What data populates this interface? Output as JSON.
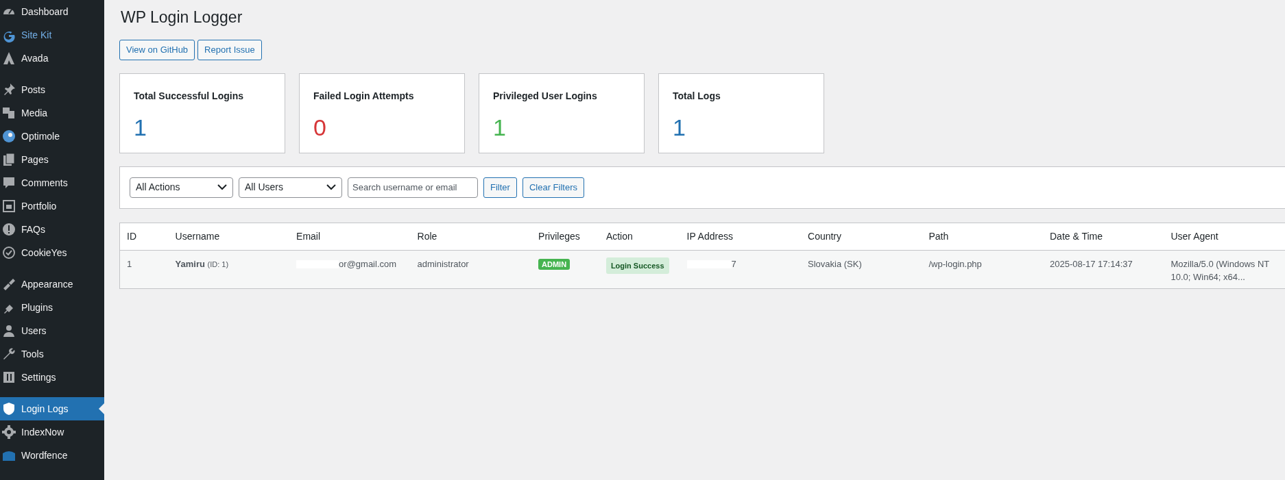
{
  "sidebar": {
    "groups": [
      {
        "items": [
          {
            "label": "Dashboard",
            "selected": false,
            "color": "#f0f0f1"
          },
          {
            "label": "Site Kit",
            "selected": false,
            "color": "#72aee6"
          },
          {
            "label": "Avada",
            "selected": false,
            "color": "#f0f0f1"
          }
        ]
      },
      {
        "items": [
          {
            "label": "Posts",
            "selected": false,
            "color": "#f0f0f1"
          },
          {
            "label": "Media",
            "selected": false,
            "color": "#f0f0f1"
          },
          {
            "label": "Optimole",
            "selected": false,
            "color": "#f0f0f1"
          },
          {
            "label": "Pages",
            "selected": false,
            "color": "#f0f0f1"
          },
          {
            "label": "Comments",
            "selected": false,
            "color": "#f0f0f1"
          },
          {
            "label": "Portfolio",
            "selected": false,
            "color": "#f0f0f1"
          },
          {
            "label": "FAQs",
            "selected": false,
            "color": "#f0f0f1"
          },
          {
            "label": "CookieYes",
            "selected": false,
            "color": "#f0f0f1"
          }
        ]
      },
      {
        "items": [
          {
            "label": "Appearance",
            "selected": false,
            "color": "#f0f0f1"
          },
          {
            "label": "Plugins",
            "selected": false,
            "color": "#f0f0f1"
          },
          {
            "label": "Users",
            "selected": false,
            "color": "#f0f0f1"
          },
          {
            "label": "Tools",
            "selected": false,
            "color": "#f0f0f1"
          },
          {
            "label": "Settings",
            "selected": false,
            "color": "#f0f0f1"
          }
        ]
      },
      {
        "items": [
          {
            "label": "Login Logs",
            "selected": true,
            "color": "#ffffff"
          },
          {
            "label": "IndexNow",
            "selected": false,
            "color": "#f0f0f1"
          },
          {
            "label": "Wordfence",
            "selected": false,
            "color": "#f0f0f1"
          }
        ]
      }
    ]
  },
  "page_title": "WP Login Logger",
  "header_buttons": [
    "View on GitHub",
    "Report Issue"
  ],
  "stats": [
    {
      "label": "Total Successful Logins",
      "value": "1",
      "color": "#2271b1"
    },
    {
      "label": "Failed Login Attempts",
      "value": "0",
      "color": "#d63638"
    },
    {
      "label": "Privileged User Logins",
      "value": "1",
      "color": "#46b450"
    },
    {
      "label": "Total Logs",
      "value": "1",
      "color": "#2271b1"
    }
  ],
  "filters": {
    "action_select": "All Actions",
    "user_select": "All Users",
    "search": {
      "placeholder": "Search username or email"
    },
    "buttons": [
      "Filter",
      "Clear Filters"
    ]
  },
  "table": {
    "columns": [
      "ID",
      "Username",
      "Email",
      "Role",
      "Privileges",
      "Action",
      "IP Address",
      "Country",
      "Path",
      "Date & Time",
      "User Agent"
    ],
    "rows": [
      {
        "id": "1",
        "username": "Yamiru",
        "user_id": "(ID: 1)",
        "email": "or@gmail.com",
        "role": "administrator",
        "privileges": "ADMIN",
        "action": "Login Success",
        "ip": "7",
        "country": "Slovakia (SK)",
        "path": "/wp-login.php",
        "datetime": "2025-08-17 17:14:37",
        "user_agent": "Mozilla/5.0 (Windows NT 10.0; Win64; x64..."
      }
    ]
  }
}
